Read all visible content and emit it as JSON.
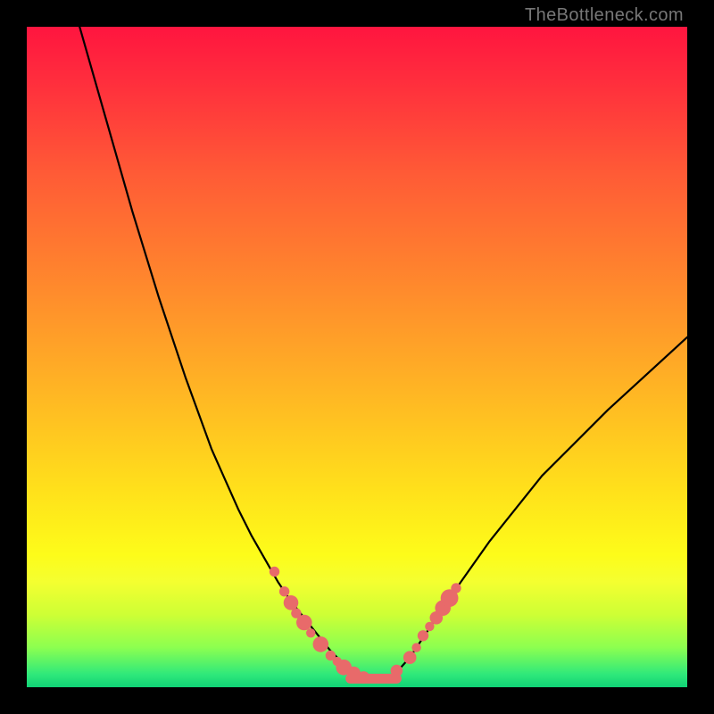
{
  "watermark": "TheBottleneck.com",
  "chart_data": {
    "type": "line",
    "title": "",
    "xlabel": "",
    "ylabel": "",
    "xlim": [
      0,
      100
    ],
    "ylim": [
      0,
      100
    ],
    "grid": false,
    "legend": false,
    "series": [
      {
        "name": "curve",
        "x": [
          8,
          12,
          16,
          20,
          24,
          28,
          32,
          34,
          36,
          38,
          40,
          42,
          44,
          46,
          48,
          50,
          52,
          54,
          56,
          58,
          60,
          64,
          70,
          78,
          88,
          100
        ],
        "values": [
          100,
          86,
          72,
          59,
          47,
          36,
          27,
          23,
          19.5,
          16,
          13,
          10.5,
          8,
          5.5,
          3.5,
          2,
          1.2,
          1.2,
          2.3,
          4.5,
          7.5,
          13.5,
          22,
          32,
          42,
          53
        ],
        "note": "y = bottleneck percentage; minimum ≈ 1.2 near x ≈ 53"
      }
    ],
    "markers": {
      "name": "highlight-dots",
      "color": "#e86a6a",
      "points": [
        {
          "x": 37.5,
          "y": 17.5,
          "r": 1.1
        },
        {
          "x": 39.0,
          "y": 14.5,
          "r": 1.1
        },
        {
          "x": 40.0,
          "y": 12.8,
          "r": 1.6
        },
        {
          "x": 40.8,
          "y": 11.2,
          "r": 1.1
        },
        {
          "x": 42.0,
          "y": 9.8,
          "r": 1.7
        },
        {
          "x": 43.0,
          "y": 8.2,
          "r": 1.0
        },
        {
          "x": 44.5,
          "y": 6.5,
          "r": 1.7
        },
        {
          "x": 46.0,
          "y": 4.8,
          "r": 1.1
        },
        {
          "x": 47.0,
          "y": 3.9,
          "r": 1.0
        },
        {
          "x": 48.0,
          "y": 3.0,
          "r": 1.7
        },
        {
          "x": 49.5,
          "y": 2.1,
          "r": 1.5
        },
        {
          "x": 51.0,
          "y": 1.5,
          "r": 1.3
        },
        {
          "x": 56.0,
          "y": 2.5,
          "r": 1.3
        },
        {
          "x": 58.0,
          "y": 4.5,
          "r": 1.4
        },
        {
          "x": 59.0,
          "y": 6.0,
          "r": 1.0
        },
        {
          "x": 60.0,
          "y": 7.8,
          "r": 1.2
        },
        {
          "x": 61.0,
          "y": 9.2,
          "r": 1.0
        },
        {
          "x": 62.0,
          "y": 10.5,
          "r": 1.4
        },
        {
          "x": 63.0,
          "y": 12.0,
          "r": 1.7
        },
        {
          "x": 64.0,
          "y": 13.5,
          "r": 1.9
        },
        {
          "x": 65.0,
          "y": 15.0,
          "r": 1.1
        }
      ]
    },
    "floor_band": {
      "from_x": 49.0,
      "to_x": 56.0,
      "y": 1.3,
      "note": "thick salmon segment along the valley floor"
    }
  }
}
